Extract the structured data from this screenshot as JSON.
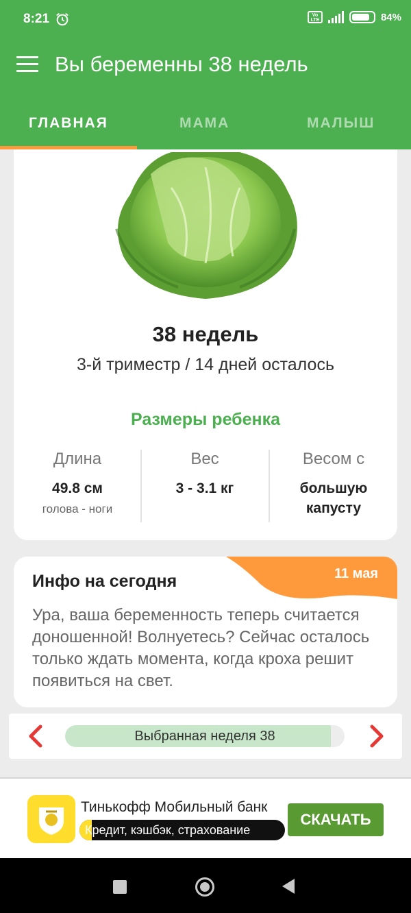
{
  "status_bar": {
    "time": "8:21",
    "network": "4G",
    "volte": "Vo LTE",
    "battery_text": "84%",
    "battery_level": 0.84
  },
  "app_bar": {
    "title": "Вы беременны 38 недель"
  },
  "tabs": [
    {
      "label": "ГЛАВНАЯ",
      "selected": true
    },
    {
      "label": "МАМА",
      "selected": false
    },
    {
      "label": "МАЛЫШ",
      "selected": false
    }
  ],
  "main_card": {
    "fruit_icon": "cabbage-image",
    "week_title": "38 недель",
    "trimester_info": "3-й триместр / 14 дней осталось",
    "sizes_title": "Размеры ребенка",
    "columns": [
      {
        "label": "Длина",
        "value": "49.8 см",
        "sub": "голова - ноги"
      },
      {
        "label": "Вес",
        "value": "3 - 3.1 кг",
        "sub": ""
      },
      {
        "label": "Весом с",
        "value": "большую капусту",
        "sub": ""
      }
    ]
  },
  "info_card": {
    "title": "Инфо на сегодня",
    "date": "11 мая",
    "text": "Ура, ваша беременность теперь считается доношенной! Волнуетесь? Сейчас осталось только ждать момента, когда кроха решит появиться на свет."
  },
  "week_selector": {
    "label": "Выбранная неделя 38",
    "progress": 0.95
  },
  "ad": {
    "title": "Тинькофф Мобильный банк",
    "subtitle": "Кредит, кэшбэк, страхование",
    "button_label": "СКАЧАТЬ"
  },
  "colors": {
    "primary": "#4caf50",
    "accent": "#ff9a3c",
    "arrow": "#e53935"
  }
}
